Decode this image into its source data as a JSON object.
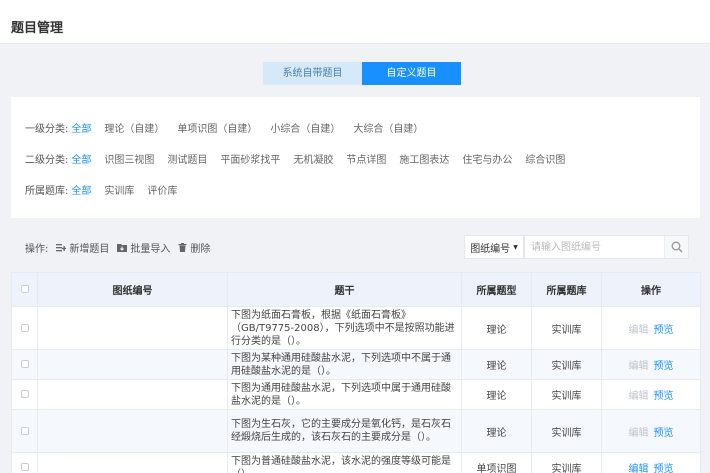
{
  "page": {
    "title": "题目管理"
  },
  "tabs": [
    {
      "label": "系统自带题目",
      "active": false
    },
    {
      "label": "自定义题目",
      "active": true
    }
  ],
  "filters": {
    "level1": {
      "label": "一级分类:",
      "items": [
        "全部",
        "理论（自建）",
        "单项识图（自建）",
        "小综合（自建）",
        "大综合（自建）"
      ]
    },
    "level2": {
      "label": "二级分类:",
      "items": [
        "全部",
        "识图三视图",
        "测试题目",
        "平面砂浆找平",
        "无机凝胶",
        "节点详图",
        "施工图表达",
        "住宅与办公",
        "综合识图"
      ]
    },
    "bank": {
      "label": "所属题库:",
      "items": [
        "全部",
        "实训库",
        "评价库"
      ]
    }
  },
  "toolbar": {
    "ops_label": "操作:",
    "add_label": "新增题目",
    "import_label": "批量导入",
    "delete_label": "删除",
    "select_value": "图纸编号",
    "search_placeholder": "请输入图纸编号"
  },
  "table": {
    "headers": [
      "图纸编号",
      "题干",
      "所属题型",
      "所属题库",
      "操作"
    ],
    "edit_label": "编辑",
    "preview_label": "预览",
    "rows": [
      {
        "code": "",
        "stem": "下图为纸面石膏板，根据《纸面石膏板》（GB/T9775-2008），下列选项中不是按照功能进行分类的是（）。",
        "type": "理论",
        "bank": "实训库"
      },
      {
        "code": "",
        "stem": "下图为某种通用硅酸盐水泥，下列选项中不属于通用硅酸盐水泥的是（）。",
        "type": "理论",
        "bank": "实训库"
      },
      {
        "code": "",
        "stem": "下图为通用硅酸盐水泥，下列选项中属于通用硅酸盐水泥的是（）。",
        "type": "理论",
        "bank": "实训库"
      },
      {
        "code": "",
        "stem": "下图为生石灰，它的主要成分是氧化钙，是石灰石经煅烧后生成的，该石灰石的主要成分是（）。",
        "type": "理论",
        "bank": "实训库"
      },
      {
        "code": "",
        "stem": "下图为普通硅酸盐水泥，该水泥的强度等级可能是（）",
        "type": "单项识图",
        "bank": "实训库"
      }
    ]
  }
}
